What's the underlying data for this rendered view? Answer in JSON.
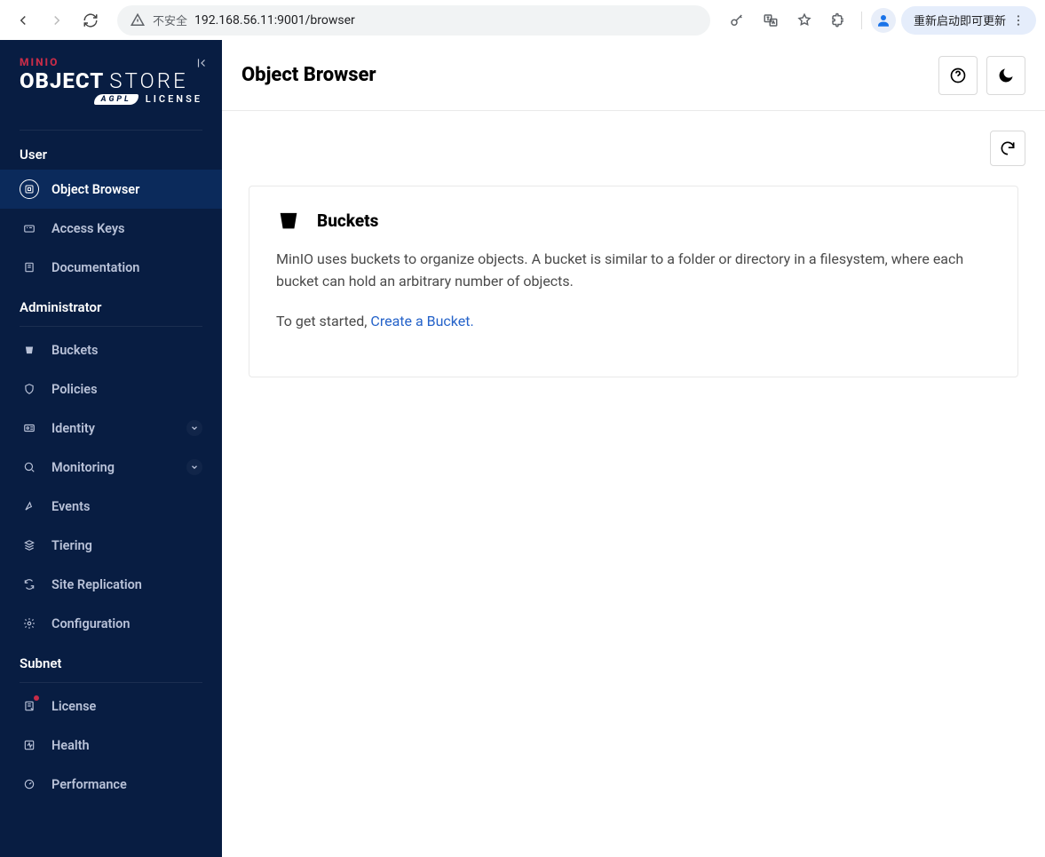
{
  "browser": {
    "security_label": "不安全",
    "url": "192.168.56.11:9001/browser",
    "update_label": "重新启动即可更新"
  },
  "logo": {
    "row1": "MINIO",
    "row2_bold": "OBJECT",
    "row2_thin": "STORE",
    "row3_badge": "AGPL",
    "row3_text": "LICENSE"
  },
  "sidebar": {
    "user_label": "User",
    "admin_label": "Administrator",
    "subnet_label": "Subnet",
    "user_items": [
      {
        "label": "Object Browser"
      },
      {
        "label": "Access Keys"
      },
      {
        "label": "Documentation"
      }
    ],
    "admin_items": [
      {
        "label": "Buckets"
      },
      {
        "label": "Policies"
      },
      {
        "label": "Identity",
        "expand": true
      },
      {
        "label": "Monitoring",
        "expand": true
      },
      {
        "label": "Events"
      },
      {
        "label": "Tiering"
      },
      {
        "label": "Site Replication"
      },
      {
        "label": "Configuration"
      }
    ],
    "subnet_items": [
      {
        "label": "License",
        "badge": true
      },
      {
        "label": "Health"
      },
      {
        "label": "Performance"
      }
    ]
  },
  "page": {
    "title": "Object Browser",
    "card_title": "Buckets",
    "card_body": "MinIO uses buckets to organize objects. A bucket is similar to a folder or directory in a filesystem, where each bucket can hold an arbitrary number of objects.",
    "cta_prefix": "To get started, ",
    "cta_text": "Create a Bucket."
  }
}
